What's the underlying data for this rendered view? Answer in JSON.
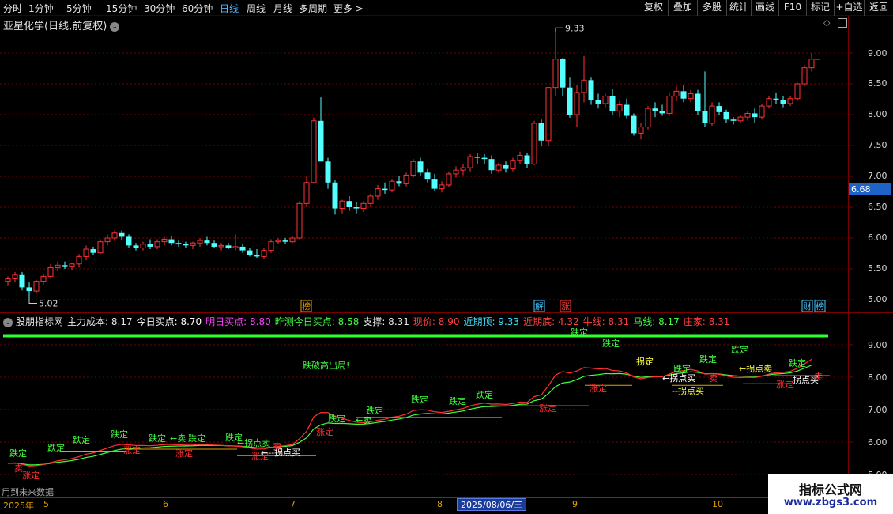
{
  "toolbar": {
    "periods": [
      "分时",
      "1分钟",
      "5分钟",
      "15分钟",
      "30分钟",
      "60分钟",
      "日线",
      "周线",
      "月线",
      "多周期",
      "更多 >"
    ],
    "active_period": "日线",
    "right_buttons": [
      "复权",
      "叠加",
      "多股",
      "统计",
      "画线",
      "F10",
      "标记",
      "+自选",
      "返回"
    ]
  },
  "stock": {
    "title": "亚星化学(日线,前复权)"
  },
  "price_axis": {
    "labels": [
      "9.00",
      "8.50",
      "8.00",
      "7.50",
      "7.00",
      "6.50",
      "6.00",
      "5.50",
      "5.00"
    ],
    "current_price": "6.68"
  },
  "markers": {
    "high": "9.33",
    "low": "5.02"
  },
  "event_badges": [
    "榜",
    "解",
    "涨",
    "财",
    "榜"
  ],
  "indicator": {
    "name": "股朋指标网",
    "fields": [
      {
        "text": "主力成本: 8.17",
        "color": "#e8e8e8"
      },
      {
        "text": "今日买点: 8.70",
        "color": "#ffffff"
      },
      {
        "text": "明日买点: 8.80",
        "color": "#ff40ff"
      },
      {
        "text": "昨测今日买点: 8.58",
        "color": "#40ff40"
      },
      {
        "text": "支撑: 8.31",
        "color": "#e8e8e8"
      },
      {
        "text": "现价: 8.90",
        "color": "#ff4040"
      },
      {
        "text": "近期顶: 9.33",
        "color": "#40e0ff"
      },
      {
        "text": "近期底: 4.32",
        "color": "#ff4040"
      },
      {
        "text": "牛线: 8.31",
        "color": "#ff4040"
      },
      {
        "text": "马线: 8.17",
        "color": "#40ff40"
      },
      {
        "text": "庄家: 8.31",
        "color": "#ff4040"
      }
    ],
    "axis_labels": [
      "9.00",
      "8.00",
      "7.00",
      "6.00",
      "5.00"
    ],
    "labels": {
      "die_ding": "跌定",
      "zhang_ding": "涨定",
      "guai_mai": "拐点买",
      "guai_mai_arrow": "←拐点买",
      "guai_mai_dash": "--拐点买",
      "guai_mai_short": "拐点买",
      "guai_mai_arrow_dash": "←--拐点买",
      "guai_sell": "←拐点卖",
      "sell": "卖",
      "sell_arrow": "←卖",
      "die_po": "跌破高出局!",
      "guai_ding": "拐定"
    },
    "bottom_note": "用到未来数据"
  },
  "date_axis": {
    "year": "2025年",
    "months": [
      "5",
      "6",
      "7",
      "8",
      "9",
      "10"
    ],
    "highlight": "2025/08/06/三"
  },
  "watermark": {
    "title": "指标公式网",
    "url": "www.zbgs3.com"
  },
  "colors": {
    "up": "#ff3232",
    "down": "#54ffff",
    "bull_line": "#ff3030",
    "horse_line": "#40ff40",
    "grid": "#7a0000"
  },
  "chart_data": {
    "type": "candlestick",
    "ylim": [
      4.9,
      9.5
    ],
    "high": 9.33,
    "low": 5.02,
    "current": 8.9,
    "ohlc": [
      [
        5.3,
        5.38,
        5.22,
        5.34
      ],
      [
        5.34,
        5.45,
        5.28,
        5.4
      ],
      [
        5.4,
        5.45,
        5.15,
        5.2
      ],
      [
        5.2,
        5.28,
        5.02,
        5.14
      ],
      [
        5.14,
        5.32,
        5.1,
        5.3
      ],
      [
        5.3,
        5.42,
        5.25,
        5.38
      ],
      [
        5.38,
        5.58,
        5.34,
        5.52
      ],
      [
        5.52,
        5.62,
        5.46,
        5.56
      ],
      [
        5.56,
        5.62,
        5.5,
        5.53
      ],
      [
        5.53,
        5.6,
        5.48,
        5.58
      ],
      [
        5.58,
        5.74,
        5.52,
        5.7
      ],
      [
        5.7,
        5.88,
        5.64,
        5.82
      ],
      [
        5.82,
        5.86,
        5.72,
        5.76
      ],
      [
        5.76,
        5.98,
        5.74,
        5.94
      ],
      [
        5.94,
        6.06,
        5.88,
        6.0
      ],
      [
        6.0,
        6.12,
        5.95,
        6.08
      ],
      [
        6.08,
        6.12,
        5.96,
        6.02
      ],
      [
        6.02,
        6.06,
        5.84,
        5.88
      ],
      [
        5.88,
        5.92,
        5.8,
        5.84
      ],
      [
        5.84,
        5.94,
        5.8,
        5.9
      ],
      [
        5.9,
        5.98,
        5.82,
        5.86
      ],
      [
        5.86,
        5.98,
        5.82,
        5.94
      ],
      [
        5.94,
        6.02,
        5.88,
        5.98
      ],
      [
        5.98,
        6.04,
        5.88,
        5.92
      ],
      [
        5.92,
        5.96,
        5.86,
        5.9
      ],
      [
        5.9,
        5.94,
        5.84,
        5.88
      ],
      [
        5.88,
        5.94,
        5.82,
        5.92
      ],
      [
        5.92,
        6.0,
        5.86,
        5.96
      ],
      [
        5.96,
        6.02,
        5.88,
        5.92
      ],
      [
        5.92,
        5.96,
        5.84,
        5.86
      ],
      [
        5.86,
        5.92,
        5.8,
        5.88
      ],
      [
        5.88,
        5.92,
        5.82,
        5.84
      ],
      [
        5.84,
        6.06,
        5.8,
        5.86
      ],
      [
        5.86,
        5.9,
        5.76,
        5.8
      ],
      [
        5.8,
        5.84,
        5.7,
        5.72
      ],
      [
        5.72,
        5.82,
        5.68,
        5.7
      ],
      [
        5.7,
        5.84,
        5.66,
        5.8
      ],
      [
        5.8,
        5.98,
        5.76,
        5.94
      ],
      [
        5.94,
        6.0,
        5.9,
        5.96
      ],
      [
        5.96,
        6.0,
        5.9,
        5.94
      ],
      [
        5.94,
        6.04,
        5.92,
        6.0
      ],
      [
        6.0,
        6.6,
        5.98,
        6.56
      ],
      [
        6.56,
        7.0,
        6.5,
        6.9
      ],
      [
        6.9,
        7.95,
        6.88,
        7.9
      ],
      [
        7.9,
        8.28,
        7.5,
        7.24
      ],
      [
        7.24,
        7.3,
        6.8,
        6.9
      ],
      [
        6.9,
        6.94,
        6.38,
        6.48
      ],
      [
        6.48,
        6.62,
        6.4,
        6.6
      ],
      [
        6.6,
        6.68,
        6.44,
        6.5
      ],
      [
        6.5,
        6.58,
        6.4,
        6.48
      ],
      [
        6.48,
        6.6,
        6.42,
        6.56
      ],
      [
        6.56,
        6.72,
        6.5,
        6.68
      ],
      [
        6.68,
        6.86,
        6.62,
        6.8
      ],
      [
        6.8,
        6.9,
        6.72,
        6.78
      ],
      [
        6.78,
        6.96,
        6.74,
        6.92
      ],
      [
        6.92,
        7.0,
        6.84,
        6.88
      ],
      [
        6.88,
        7.06,
        6.84,
        7.02
      ],
      [
        7.02,
        7.28,
        6.98,
        7.24
      ],
      [
        7.24,
        7.3,
        7.0,
        7.06
      ],
      [
        7.06,
        7.12,
        6.9,
        6.96
      ],
      [
        6.96,
        7.04,
        6.76,
        6.8
      ],
      [
        6.8,
        6.92,
        6.74,
        6.86
      ],
      [
        6.86,
        7.08,
        6.82,
        7.04
      ],
      [
        7.04,
        7.16,
        6.98,
        7.1
      ],
      [
        7.1,
        7.2,
        7.02,
        7.14
      ],
      [
        7.14,
        7.36,
        7.08,
        7.32
      ],
      [
        7.32,
        7.38,
        7.2,
        7.3
      ],
      [
        7.3,
        7.36,
        7.2,
        7.28
      ],
      [
        7.28,
        7.34,
        7.04,
        7.1
      ],
      [
        7.1,
        7.22,
        7.06,
        7.18
      ],
      [
        7.18,
        7.24,
        7.06,
        7.12
      ],
      [
        7.12,
        7.3,
        7.08,
        7.26
      ],
      [
        7.26,
        7.4,
        7.2,
        7.34
      ],
      [
        7.34,
        7.38,
        7.14,
        7.2
      ],
      [
        7.2,
        7.9,
        7.18,
        7.86
      ],
      [
        7.86,
        7.92,
        7.5,
        7.58
      ],
      [
        7.58,
        8.45,
        7.5,
        8.44
      ],
      [
        8.44,
        9.33,
        8.3,
        8.9
      ],
      [
        8.9,
        8.92,
        8.3,
        8.44
      ],
      [
        8.44,
        8.6,
        7.95,
        8.0
      ],
      [
        8.0,
        8.48,
        7.8,
        8.36
      ],
      [
        8.36,
        8.95,
        8.2,
        8.56
      ],
      [
        8.56,
        8.6,
        8.16,
        8.24
      ],
      [
        8.24,
        8.34,
        8.1,
        8.18
      ],
      [
        8.18,
        8.34,
        8.12,
        8.3
      ],
      [
        8.3,
        8.42,
        8.0,
        8.06
      ],
      [
        8.06,
        8.22,
        7.96,
        8.16
      ],
      [
        8.16,
        8.26,
        7.94,
        7.98
      ],
      [
        7.98,
        8.02,
        7.66,
        7.7
      ],
      [
        7.7,
        7.86,
        7.6,
        7.8
      ],
      [
        7.8,
        8.14,
        7.76,
        8.1
      ],
      [
        8.1,
        8.2,
        7.96,
        8.06
      ],
      [
        8.06,
        8.16,
        7.98,
        8.02
      ],
      [
        8.02,
        8.36,
        7.98,
        8.3
      ],
      [
        8.3,
        8.46,
        8.22,
        8.38
      ],
      [
        8.38,
        8.48,
        8.2,
        8.26
      ],
      [
        8.26,
        8.4,
        8.2,
        8.34
      ],
      [
        8.34,
        8.4,
        8.0,
        8.06
      ],
      [
        8.06,
        8.7,
        7.8,
        7.86
      ],
      [
        7.86,
        8.2,
        7.82,
        8.14
      ],
      [
        8.14,
        8.2,
        8.0,
        8.04
      ],
      [
        8.04,
        8.08,
        7.86,
        7.92
      ],
      [
        7.92,
        7.96,
        7.84,
        7.9
      ],
      [
        7.9,
        8.0,
        7.86,
        7.96
      ],
      [
        7.96,
        8.06,
        7.9,
        8.02
      ],
      [
        8.02,
        8.1,
        7.86,
        7.96
      ],
      [
        7.96,
        8.18,
        7.92,
        8.14
      ],
      [
        8.14,
        8.3,
        8.1,
        8.26
      ],
      [
        8.26,
        8.36,
        8.18,
        8.24
      ],
      [
        8.24,
        8.3,
        8.12,
        8.18
      ],
      [
        8.18,
        8.3,
        8.14,
        8.26
      ],
      [
        8.26,
        8.52,
        8.22,
        8.5
      ],
      [
        8.5,
        8.8,
        8.46,
        8.76
      ],
      [
        8.76,
        9.0,
        8.7,
        8.9
      ]
    ]
  }
}
